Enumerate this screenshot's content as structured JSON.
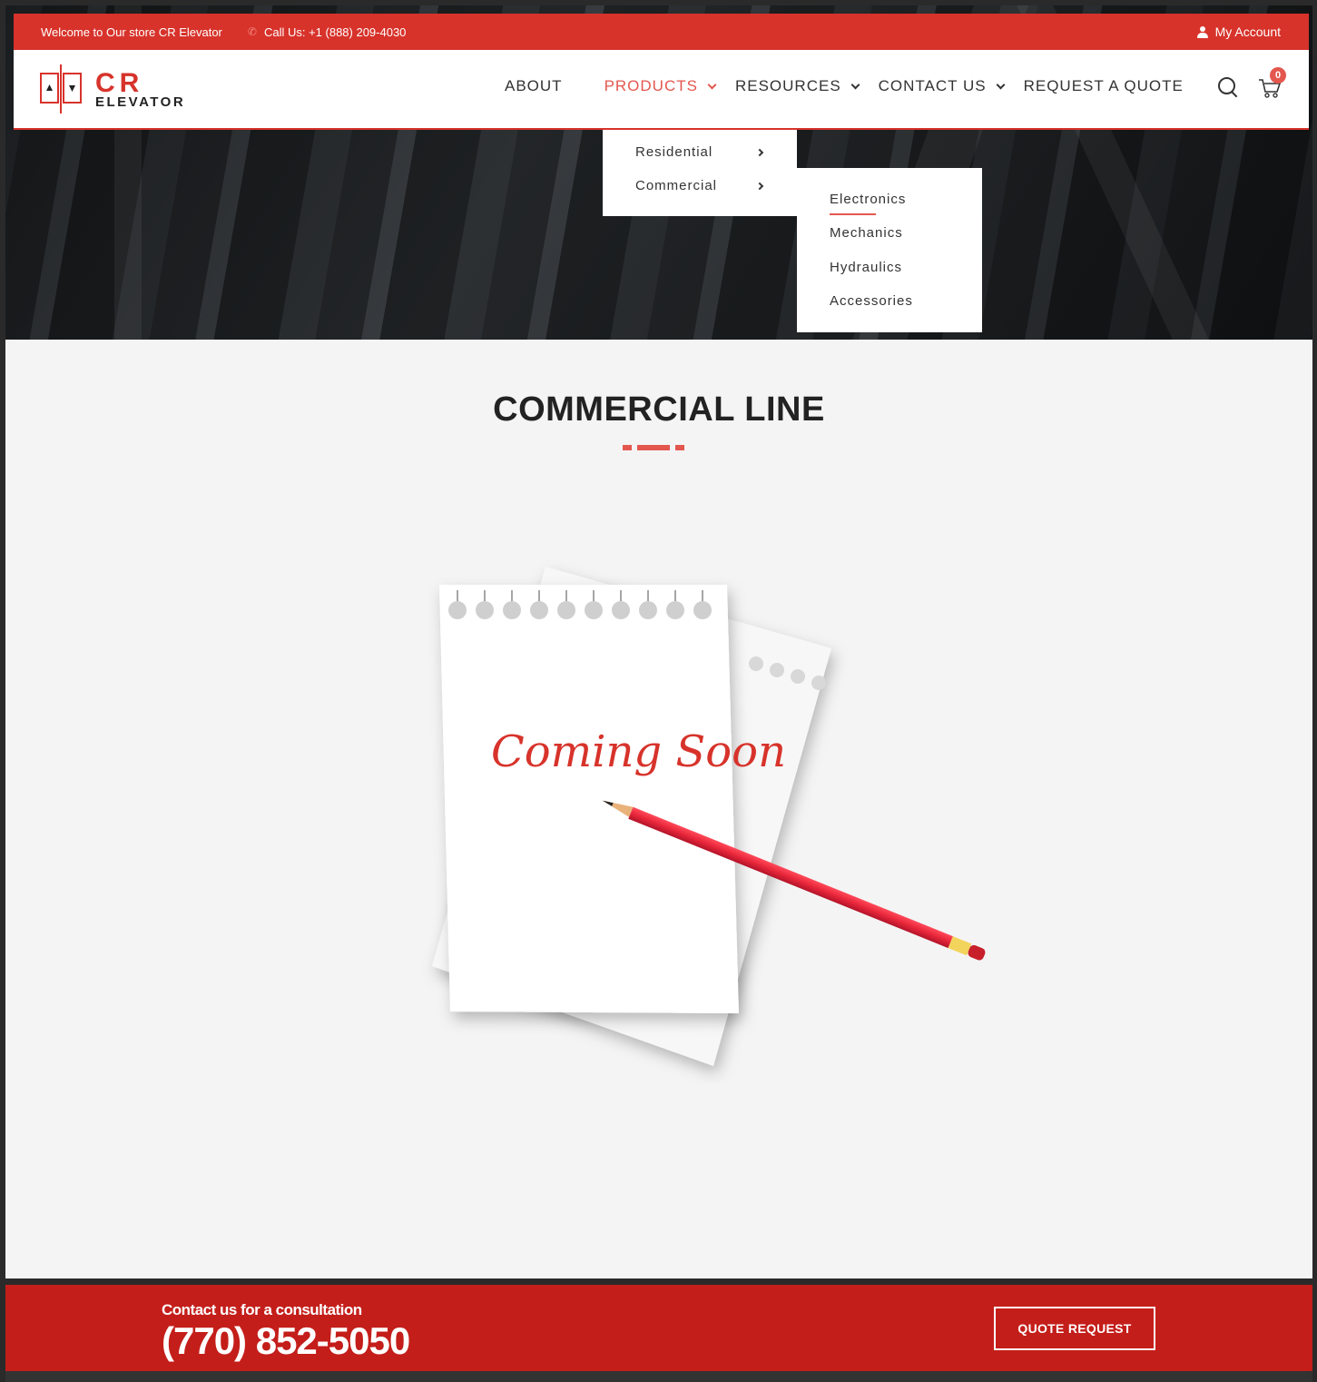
{
  "topbar": {
    "welcome": "Welcome to Our store CR Elevator",
    "phone": "Call Us: +1 (888) 209-4030",
    "account": "My Account"
  },
  "brand": {
    "line1": "CR",
    "line2": "ELEVATOR"
  },
  "nav": {
    "items": [
      {
        "label": "ABOUT"
      },
      {
        "label": "PRODUCTS"
      },
      {
        "label": "RESOURCES"
      },
      {
        "label": "CONTACT US"
      },
      {
        "label": "REQUEST A QUOTE"
      }
    ],
    "cart_count": "0"
  },
  "products_menu": {
    "items": [
      {
        "label": "Residential"
      },
      {
        "label": "Commercial"
      }
    ]
  },
  "commercial_menu": {
    "items": [
      {
        "label": "Electronics"
      },
      {
        "label": "Mechanics"
      },
      {
        "label": "Hydraulics"
      },
      {
        "label": "Accessories"
      }
    ]
  },
  "page": {
    "title": "COMMERCIAL LINE",
    "image_text": "Coming Soon"
  },
  "cta": {
    "label": "Contact us for a consultation",
    "phone": "(770) 852-5050",
    "button": "QUOTE REQUEST"
  },
  "colors": {
    "brand_red": "#d7332b",
    "accent": "#e4574f",
    "cta_red": "#c41e1a"
  }
}
